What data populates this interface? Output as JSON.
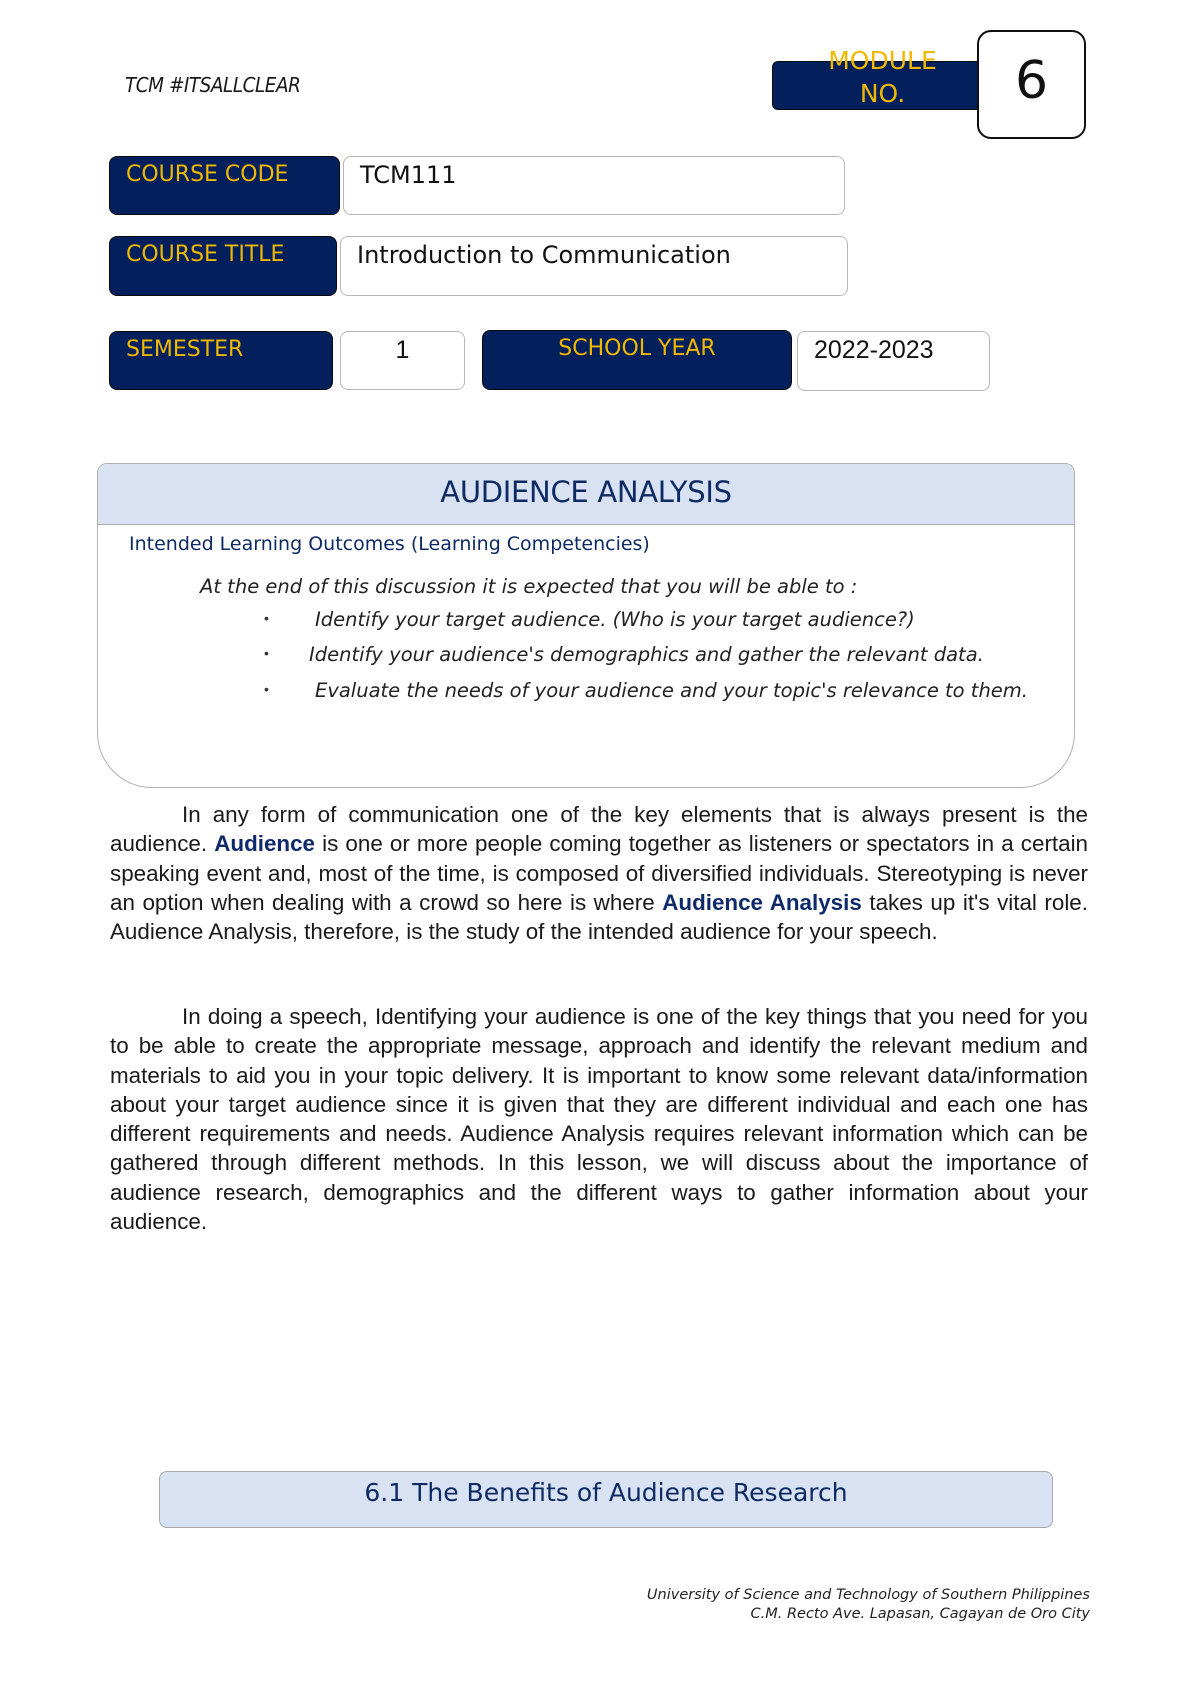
{
  "header": {
    "brand_tag": "TCM #ITSALLCLEAR",
    "module_label_line1": "MODULE",
    "module_label_line2": "NO.",
    "module_number": "6"
  },
  "course_info": {
    "course_code_label": "COURSE  CODE",
    "course_code": "TCM111",
    "course_title_label": "COURSE TITLE",
    "course_title": "Introduction to Communication",
    "semester_label": "SEMESTER",
    "semester": "1",
    "school_year_label": "SCHOOL YEAR",
    "school_year": "2022-2023"
  },
  "outcomes": {
    "title": "AUDIENCE ANALYSIS",
    "heading": "Intended Learning Outcomes (Learning Competencies)",
    "intro": "At the end of this discussion it is expected that you will be able to :",
    "bullet": "•",
    "items": [
      "Identify your target audience. (Who is your target audience?)",
      "Identify your audience's demographics and gather the relevant data.",
      "Evaluate the needs of your audience and your topic's relevance to them."
    ]
  },
  "body": {
    "p1": {
      "a": "In any form of communication one of the key elements that is always present is the audience. ",
      "b": "Audience",
      "c": " is one or more people coming together as listeners or spectators in a certain speaking event and, most of the time, is composed of diversified individuals. Stereotyping is never an option when dealing with a crowd so here is where ",
      "d": "Audience Analysis",
      "e": " takes up it's vital role. Audience Analysis, therefore, is the study of the intended audience for your speech."
    },
    "p2": "In doing a speech, Identifying your audience is one of the key things that you need for you to be able to create the appropriate message, approach and identify the relevant medium and materials to aid you in your topic delivery. It is important to know some relevant data/information about your target audience  since it is given that they are different individual and each one has different requirements and needs. Audience Analysis requires relevant information which can be gathered through different methods. In this lesson, we will discuss about the importance of audience research, demographics and the different ways to gather information about your audience."
  },
  "section": {
    "title": "6.1 The Benefits of Audience Research"
  },
  "footer": {
    "line1": "University of Science and Technology of Southern Philippines",
    "line2": "C.M. Recto Ave. Lapasan, Cagayan de Oro City"
  },
  "colors": {
    "navy": "#03205c",
    "gold": "#f0b800",
    "light_blue_band": "#d9e2f2",
    "heading_blue": "#0e2a63"
  }
}
